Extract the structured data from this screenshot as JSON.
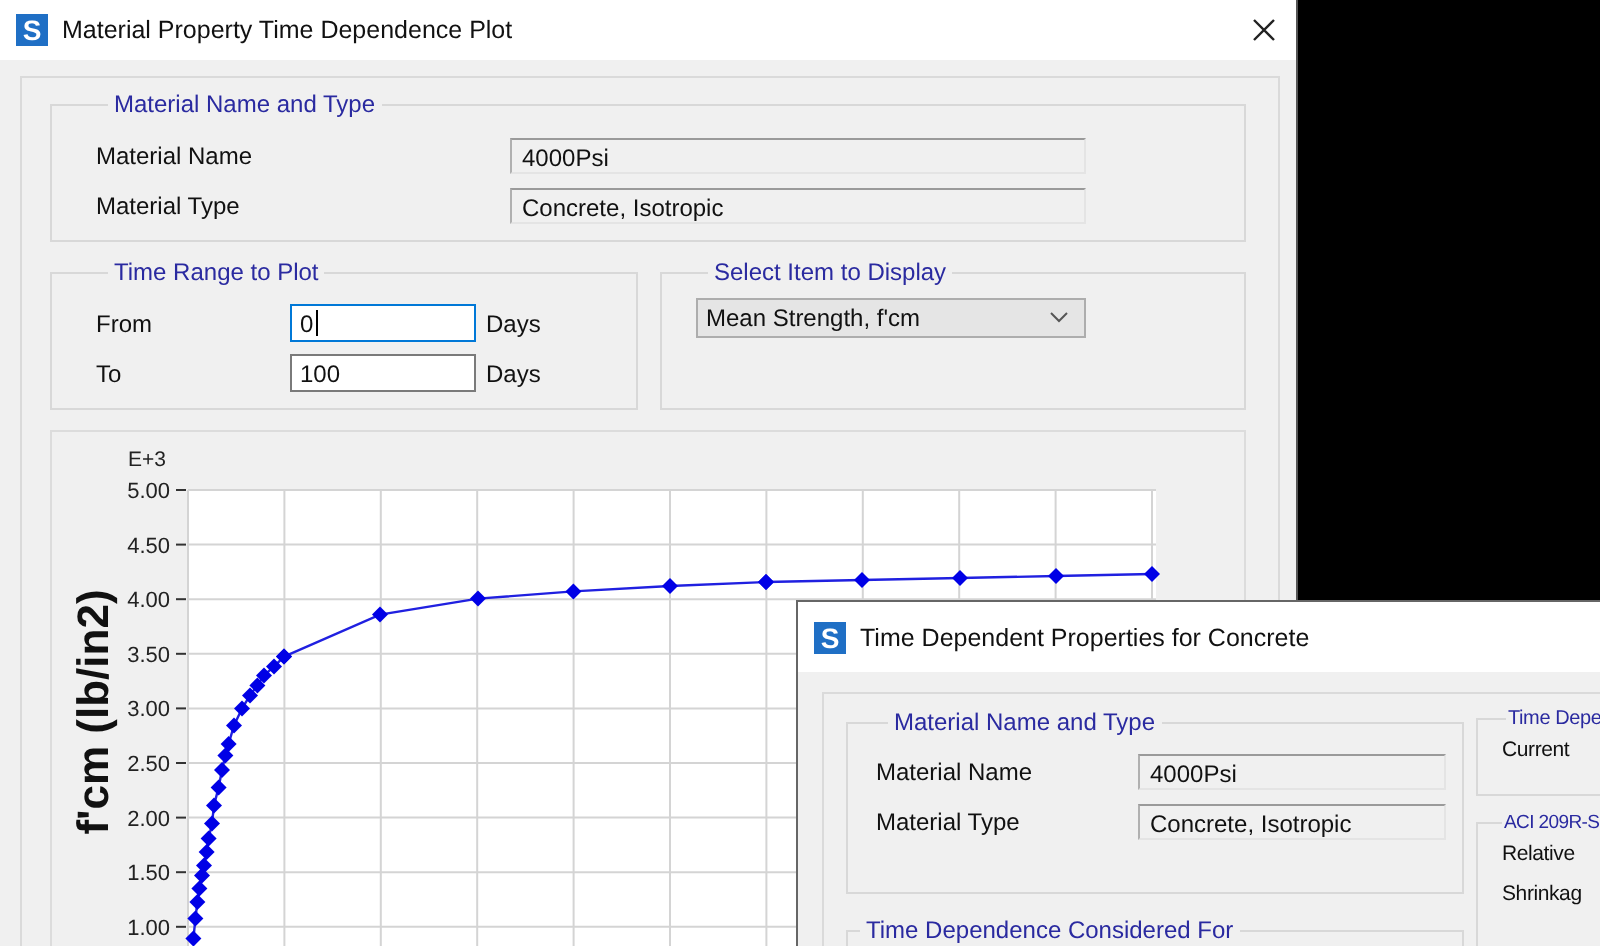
{
  "plot_window": {
    "logo": "S",
    "title": "Material Property Time Dependence Plot",
    "material_group": {
      "title": "Material Name and Type",
      "fields": [
        {
          "label": "Material Name",
          "value": "4000Psi"
        },
        {
          "label": "Material Type",
          "value": "Concrete, Isotropic"
        }
      ]
    },
    "time_range": {
      "title": "Time Range to Plot",
      "fields": [
        {
          "label": "From",
          "value": "0",
          "unit": "Days",
          "focused": true
        },
        {
          "label": "To",
          "value": "100",
          "unit": "Days",
          "focused": false
        }
      ]
    },
    "display_item": {
      "title": "Select Item to Display",
      "value": "Mean Strength, f'cm"
    },
    "chart": {
      "exponent": "E+3",
      "ylabel": "f'cm (lb/in2)",
      "yticks": [
        "5.00",
        "4.50",
        "4.00",
        "3.50",
        "3.00",
        "2.50",
        "2.00",
        "1.50",
        "1.00"
      ]
    }
  },
  "properties_window": {
    "logo": "S",
    "title": "Time Dependent Properties for Concrete",
    "material_group": {
      "title": "Material Name and Type",
      "fields": [
        {
          "label": "Material Name",
          "value": "4000Psi"
        },
        {
          "label": "Material Type",
          "value": "Concrete, Isotropic"
        }
      ]
    },
    "time_dependence_group": {
      "title": "Time Depe",
      "items": [
        "Current"
      ]
    },
    "aci_group": {
      "title": "ACI 209R-S",
      "items": [
        "Relative",
        "Shrinkag"
      ]
    },
    "considered_group": {
      "title": "Time Dependence Considered For"
    }
  }
}
